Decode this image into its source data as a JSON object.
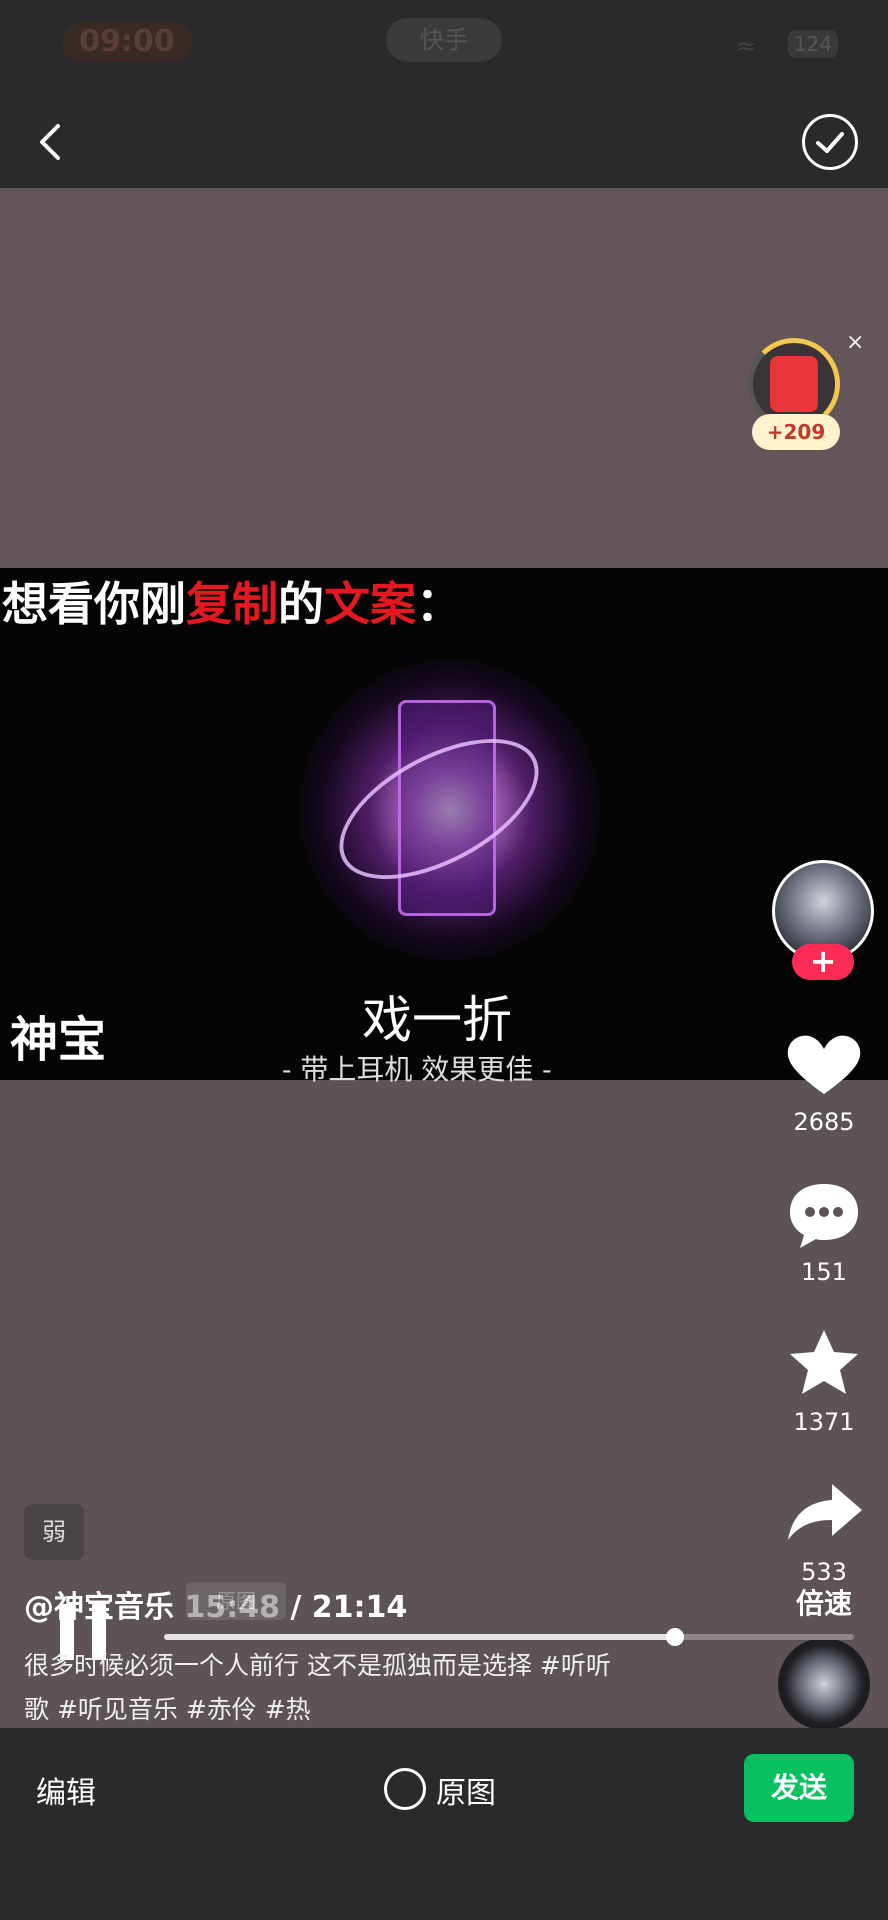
{
  "status_bar": {
    "time": "09:00",
    "app_label": "快手",
    "network": "≈",
    "battery": "124"
  },
  "header": {
    "back_icon": "back-arrow-icon",
    "confirm_icon": "check-circle-icon"
  },
  "overlay": {
    "title_parts": [
      "想看你刚",
      "复制",
      "的",
      "文案",
      "："
    ],
    "card_name": "神宝",
    "song_title": "戏一折",
    "song_subtitle": "- 带上耳机 效果更佳 -"
  },
  "red_packet": {
    "close_label": "×",
    "badge": "+209"
  },
  "actions": {
    "likes": "2685",
    "comments": "151",
    "favorites": "1371",
    "shares": "533",
    "speed_label": "倍速",
    "follow_label": "+"
  },
  "info": {
    "tag_chip": "弱",
    "author": "@神宝音乐",
    "timecode": "15:48 / 21:14",
    "mode_chip": "原图",
    "caption_line1": "很多时候必须一个人前行 这不是孤独而是选择 #听听",
    "caption_line2": "歌 #听见音乐 #赤伶 #热",
    "progress": 0.74
  },
  "bottom_bar": {
    "edit_label": "编辑",
    "original_label": "原图",
    "send_label": "发送"
  },
  "colors": {
    "send_green": "#07c160",
    "follow_red": "#fe2c55",
    "title_red": "#e4191f"
  }
}
